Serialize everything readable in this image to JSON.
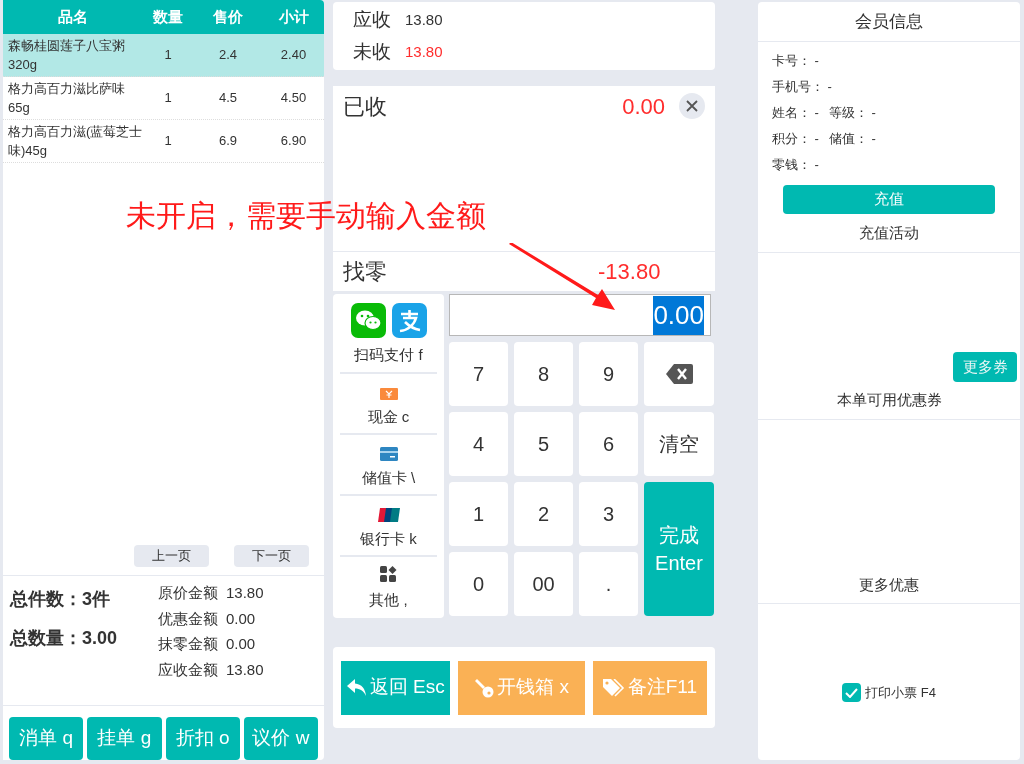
{
  "cart": {
    "columns": [
      "品名",
      "数量",
      "售价",
      "小计"
    ],
    "rows": [
      {
        "cells": [
          "森畅桂圆莲子八宝粥320g",
          "1",
          "2.4",
          "2.40"
        ],
        "selected": true
      },
      {
        "cells": [
          "格力高百力滋比萨味65g",
          "1",
          "4.5",
          "4.50"
        ],
        "selected": false
      },
      {
        "cells": [
          "格力高百力滋(蓝莓芝士味)45g",
          "1",
          "6.9",
          "6.90"
        ],
        "selected": false
      }
    ],
    "pager": [
      "上一页",
      "下一页"
    ],
    "totals": [
      {
        "label": "总件数：",
        "value": "3件"
      },
      {
        "label": "总数量：",
        "value": "3.00"
      }
    ],
    "amounts": [
      {
        "label": "原价金额",
        "value": "13.80"
      },
      {
        "label": "优惠金额",
        "value": "0.00"
      },
      {
        "label": "抹零金额",
        "value": "0.00"
      },
      {
        "label": "应收金额",
        "value": "13.80"
      }
    ],
    "actions": [
      "消单 q",
      "挂单 g",
      "折扣 o",
      "议价 w"
    ]
  },
  "due": [
    {
      "label": "应收",
      "value": "13.80",
      "alert": false
    },
    {
      "label": "未收",
      "value": "13.80",
      "alert": true
    }
  ],
  "received": {
    "label": "已收",
    "value": "0.00"
  },
  "change": {
    "label": "找零",
    "value": "-13.80"
  },
  "payment_methods": [
    {
      "kind": "scan",
      "label": "扫码支付 f"
    },
    {
      "kind": "cash",
      "label": "现金 c"
    },
    {
      "kind": "stored",
      "label": "储值卡 \\"
    },
    {
      "kind": "bank",
      "label": "银行卡 k"
    },
    {
      "kind": "other",
      "label": "其他 ,"
    }
  ],
  "amount_input": {
    "value": "0.00",
    "text_selected": true
  },
  "keypad": [
    {
      "kind": "digit",
      "label": "7"
    },
    {
      "kind": "digit",
      "label": "8"
    },
    {
      "kind": "digit",
      "label": "9"
    },
    {
      "kind": "backspace"
    },
    {
      "kind": "digit",
      "label": "4"
    },
    {
      "kind": "digit",
      "label": "5"
    },
    {
      "kind": "digit",
      "label": "6"
    },
    {
      "kind": "clear",
      "label": "清空"
    },
    {
      "kind": "digit",
      "label": "1"
    },
    {
      "kind": "digit",
      "label": "2"
    },
    {
      "kind": "digit",
      "label": "3"
    },
    {
      "kind": "enter",
      "label": "完成",
      "sublabel": "Enter"
    },
    {
      "kind": "digit",
      "label": "0"
    },
    {
      "kind": "digit",
      "label": "00"
    },
    {
      "kind": "digit",
      "label": "."
    }
  ],
  "bottom_buttons": [
    {
      "kind": "back",
      "label": "返回 Esc",
      "color": "#00b9b1"
    },
    {
      "kind": "drawer",
      "label": "开钱箱 x",
      "color": "#fab155"
    },
    {
      "kind": "note",
      "label": "备注F11",
      "color": "#fab155"
    }
  ],
  "member": {
    "title": "会员信息",
    "lines": [
      [
        {
          "label": "卡号：",
          "value": "-"
        }
      ],
      [
        {
          "label": "手机号：",
          "value": "-"
        }
      ],
      [
        {
          "label": "姓名：",
          "value": "-"
        },
        {
          "label": "等级：",
          "value": "-"
        }
      ],
      [
        {
          "label": "积分：",
          "value": "-"
        },
        {
          "label": "储值：",
          "value": "-"
        }
      ],
      [
        {
          "label": "零钱：",
          "value": "-"
        }
      ]
    ],
    "recharge_button": "充值",
    "recharge_title": "充值活动",
    "more_coupons": "更多券",
    "coupons_title": "本单可用优惠券",
    "more_offers_title": "更多优惠",
    "print_receipt": {
      "label": "打印小票 F4",
      "checked": true
    }
  },
  "annotation": {
    "text": "未开启，需要手动输入金额"
  }
}
